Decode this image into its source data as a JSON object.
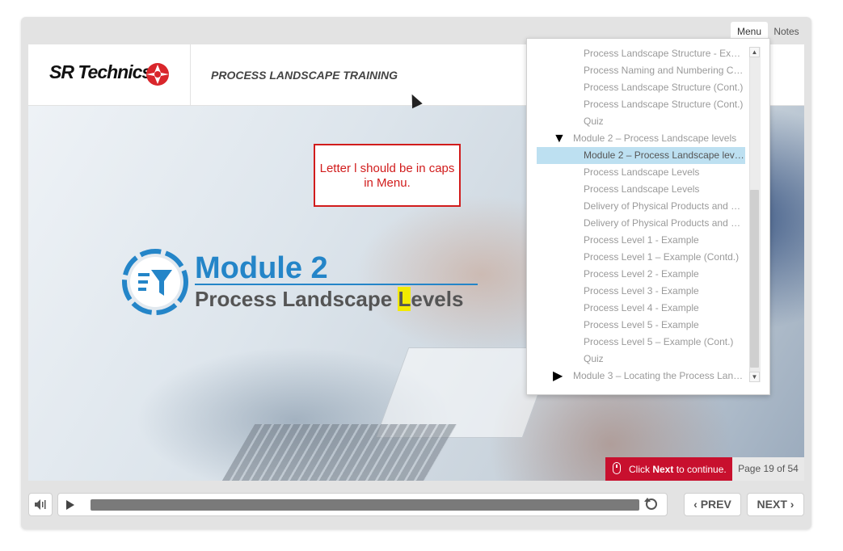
{
  "header": {
    "logo_text": "SR Technics",
    "title": "PROCESS LANDSCAPE TRAINING"
  },
  "tabs": {
    "menu": "Menu",
    "notes": "Notes"
  },
  "slide": {
    "module_title": "Module 2",
    "subtitle_before": "Process Landscape ",
    "subtitle_highlight": "L",
    "subtitle_after": "evels",
    "callout": "Letter l should be in caps in Menu."
  },
  "menu": {
    "items": [
      {
        "label": "Process Landscape Structure - Examp...",
        "state": "normal"
      },
      {
        "label": "Process Naming and Numbering Con...",
        "state": "normal"
      },
      {
        "label": "Process Landscape Structure (Cont.)",
        "state": "normal"
      },
      {
        "label": "Process Landscape Structure (Cont.)",
        "state": "normal"
      },
      {
        "label": "Quiz",
        "state": "normal"
      },
      {
        "label": "Module 2 – Process Landscape levels",
        "state": "expanded-section"
      },
      {
        "label": "Module 2 – Process Landscape levels",
        "state": "selected"
      },
      {
        "label": "Process Landscape Levels",
        "state": "normal"
      },
      {
        "label": "Process Landscape Levels",
        "state": "normal"
      },
      {
        "label": "Delivery of Physical Products and Serv...",
        "state": "normal"
      },
      {
        "label": "Delivery of Physical Products and Serv...",
        "state": "normal"
      },
      {
        "label": "Process Level 1 - Example",
        "state": "normal"
      },
      {
        "label": "Process Level 1 – Example (Contd.)",
        "state": "normal"
      },
      {
        "label": "Process Level 2 - Example",
        "state": "normal"
      },
      {
        "label": "Process Level 3 - Example",
        "state": "normal"
      },
      {
        "label": "Process Level 4 - Example",
        "state": "normal"
      },
      {
        "label": "Process Level 5 - Example",
        "state": "normal"
      },
      {
        "label": "Process Level 5 – Example (Cont.)",
        "state": "normal"
      },
      {
        "label": "Quiz",
        "state": "normal"
      },
      {
        "label": "Module 3 – Locating the Process Landsc...",
        "state": "collapsed-section"
      }
    ]
  },
  "status": {
    "click_prefix": "Click ",
    "click_bold": "Next",
    "click_suffix": " to continue.",
    "page": "Page 19 of 54"
  },
  "controls": {
    "prev_label": "PREV",
    "next_label": "NEXT"
  },
  "colors": {
    "accent_blue": "#2485c8",
    "alert_red": "#c8102e",
    "highlight_yellow": "#f3ea00",
    "menu_selected": "#bde0f1"
  }
}
